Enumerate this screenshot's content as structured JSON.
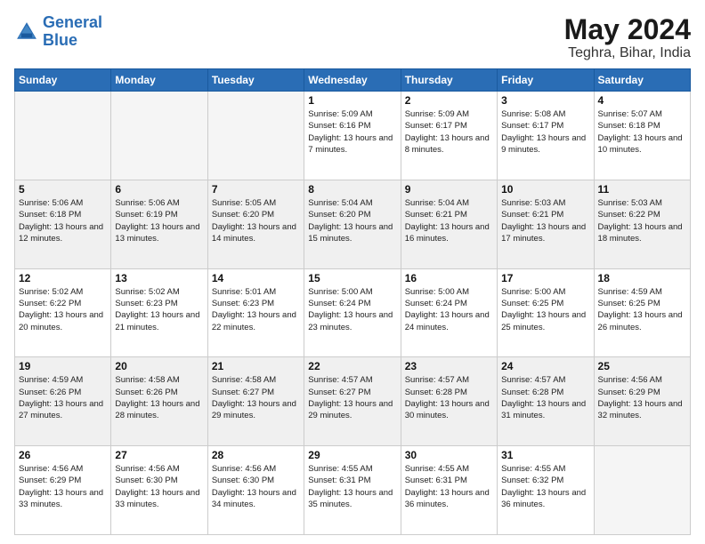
{
  "logo": {
    "line1": "General",
    "line2": "Blue"
  },
  "title": "May 2024",
  "location": "Teghra, Bihar, India",
  "weekdays": [
    "Sunday",
    "Monday",
    "Tuesday",
    "Wednesday",
    "Thursday",
    "Friday",
    "Saturday"
  ],
  "rows": [
    {
      "shaded": false,
      "cells": [
        {
          "day": "",
          "empty": true
        },
        {
          "day": "",
          "empty": true
        },
        {
          "day": "",
          "empty": true
        },
        {
          "day": "1",
          "sun": "5:09 AM",
          "set": "6:16 PM",
          "day_hours": "13 hours and 7 minutes."
        },
        {
          "day": "2",
          "sun": "5:09 AM",
          "set": "6:17 PM",
          "day_hours": "13 hours and 8 minutes."
        },
        {
          "day": "3",
          "sun": "5:08 AM",
          "set": "6:17 PM",
          "day_hours": "13 hours and 9 minutes."
        },
        {
          "day": "4",
          "sun": "5:07 AM",
          "set": "6:18 PM",
          "day_hours": "13 hours and 10 minutes."
        }
      ]
    },
    {
      "shaded": true,
      "cells": [
        {
          "day": "5",
          "sun": "5:06 AM",
          "set": "6:18 PM",
          "day_hours": "13 hours and 12 minutes."
        },
        {
          "day": "6",
          "sun": "5:06 AM",
          "set": "6:19 PM",
          "day_hours": "13 hours and 13 minutes."
        },
        {
          "day": "7",
          "sun": "5:05 AM",
          "set": "6:20 PM",
          "day_hours": "13 hours and 14 minutes."
        },
        {
          "day": "8",
          "sun": "5:04 AM",
          "set": "6:20 PM",
          "day_hours": "13 hours and 15 minutes."
        },
        {
          "day": "9",
          "sun": "5:04 AM",
          "set": "6:21 PM",
          "day_hours": "13 hours and 16 minutes."
        },
        {
          "day": "10",
          "sun": "5:03 AM",
          "set": "6:21 PM",
          "day_hours": "13 hours and 17 minutes."
        },
        {
          "day": "11",
          "sun": "5:03 AM",
          "set": "6:22 PM",
          "day_hours": "13 hours and 18 minutes."
        }
      ]
    },
    {
      "shaded": false,
      "cells": [
        {
          "day": "12",
          "sun": "5:02 AM",
          "set": "6:22 PM",
          "day_hours": "13 hours and 20 minutes."
        },
        {
          "day": "13",
          "sun": "5:02 AM",
          "set": "6:23 PM",
          "day_hours": "13 hours and 21 minutes."
        },
        {
          "day": "14",
          "sun": "5:01 AM",
          "set": "6:23 PM",
          "day_hours": "13 hours and 22 minutes."
        },
        {
          "day": "15",
          "sun": "5:00 AM",
          "set": "6:24 PM",
          "day_hours": "13 hours and 23 minutes."
        },
        {
          "day": "16",
          "sun": "5:00 AM",
          "set": "6:24 PM",
          "day_hours": "13 hours and 24 minutes."
        },
        {
          "day": "17",
          "sun": "5:00 AM",
          "set": "6:25 PM",
          "day_hours": "13 hours and 25 minutes."
        },
        {
          "day": "18",
          "sun": "4:59 AM",
          "set": "6:25 PM",
          "day_hours": "13 hours and 26 minutes."
        }
      ]
    },
    {
      "shaded": true,
      "cells": [
        {
          "day": "19",
          "sun": "4:59 AM",
          "set": "6:26 PM",
          "day_hours": "13 hours and 27 minutes."
        },
        {
          "day": "20",
          "sun": "4:58 AM",
          "set": "6:26 PM",
          "day_hours": "13 hours and 28 minutes."
        },
        {
          "day": "21",
          "sun": "4:58 AM",
          "set": "6:27 PM",
          "day_hours": "13 hours and 29 minutes."
        },
        {
          "day": "22",
          "sun": "4:57 AM",
          "set": "6:27 PM",
          "day_hours": "13 hours and 29 minutes."
        },
        {
          "day": "23",
          "sun": "4:57 AM",
          "set": "6:28 PM",
          "day_hours": "13 hours and 30 minutes."
        },
        {
          "day": "24",
          "sun": "4:57 AM",
          "set": "6:28 PM",
          "day_hours": "13 hours and 31 minutes."
        },
        {
          "day": "25",
          "sun": "4:56 AM",
          "set": "6:29 PM",
          "day_hours": "13 hours and 32 minutes."
        }
      ]
    },
    {
      "shaded": false,
      "cells": [
        {
          "day": "26",
          "sun": "4:56 AM",
          "set": "6:29 PM",
          "day_hours": "13 hours and 33 minutes."
        },
        {
          "day": "27",
          "sun": "4:56 AM",
          "set": "6:30 PM",
          "day_hours": "13 hours and 33 minutes."
        },
        {
          "day": "28",
          "sun": "4:56 AM",
          "set": "6:30 PM",
          "day_hours": "13 hours and 34 minutes."
        },
        {
          "day": "29",
          "sun": "4:55 AM",
          "set": "6:31 PM",
          "day_hours": "13 hours and 35 minutes."
        },
        {
          "day": "30",
          "sun": "4:55 AM",
          "set": "6:31 PM",
          "day_hours": "13 hours and 36 minutes."
        },
        {
          "day": "31",
          "sun": "4:55 AM",
          "set": "6:32 PM",
          "day_hours": "13 hours and 36 minutes."
        },
        {
          "day": "",
          "empty": true
        }
      ]
    }
  ]
}
